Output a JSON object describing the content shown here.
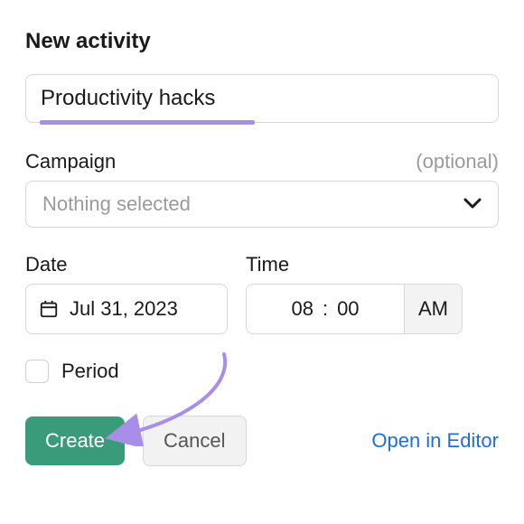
{
  "heading": "New activity",
  "name_input": {
    "value": "Productivity hacks"
  },
  "campaign": {
    "label": "Campaign",
    "optional_text": "(optional)",
    "placeholder": "Nothing selected"
  },
  "date": {
    "label": "Date",
    "value": "Jul 31, 2023"
  },
  "time": {
    "label": "Time",
    "hour": "08",
    "sep": ":",
    "minute": "00",
    "ampm": "AM"
  },
  "period": {
    "label": "Period",
    "checked": false
  },
  "buttons": {
    "create": "Create",
    "cancel": "Cancel",
    "open_editor": "Open in Editor"
  },
  "colors": {
    "create_bg": "#3a9b7a",
    "link": "#1f6fd6",
    "annotation": "#a88ee8"
  }
}
